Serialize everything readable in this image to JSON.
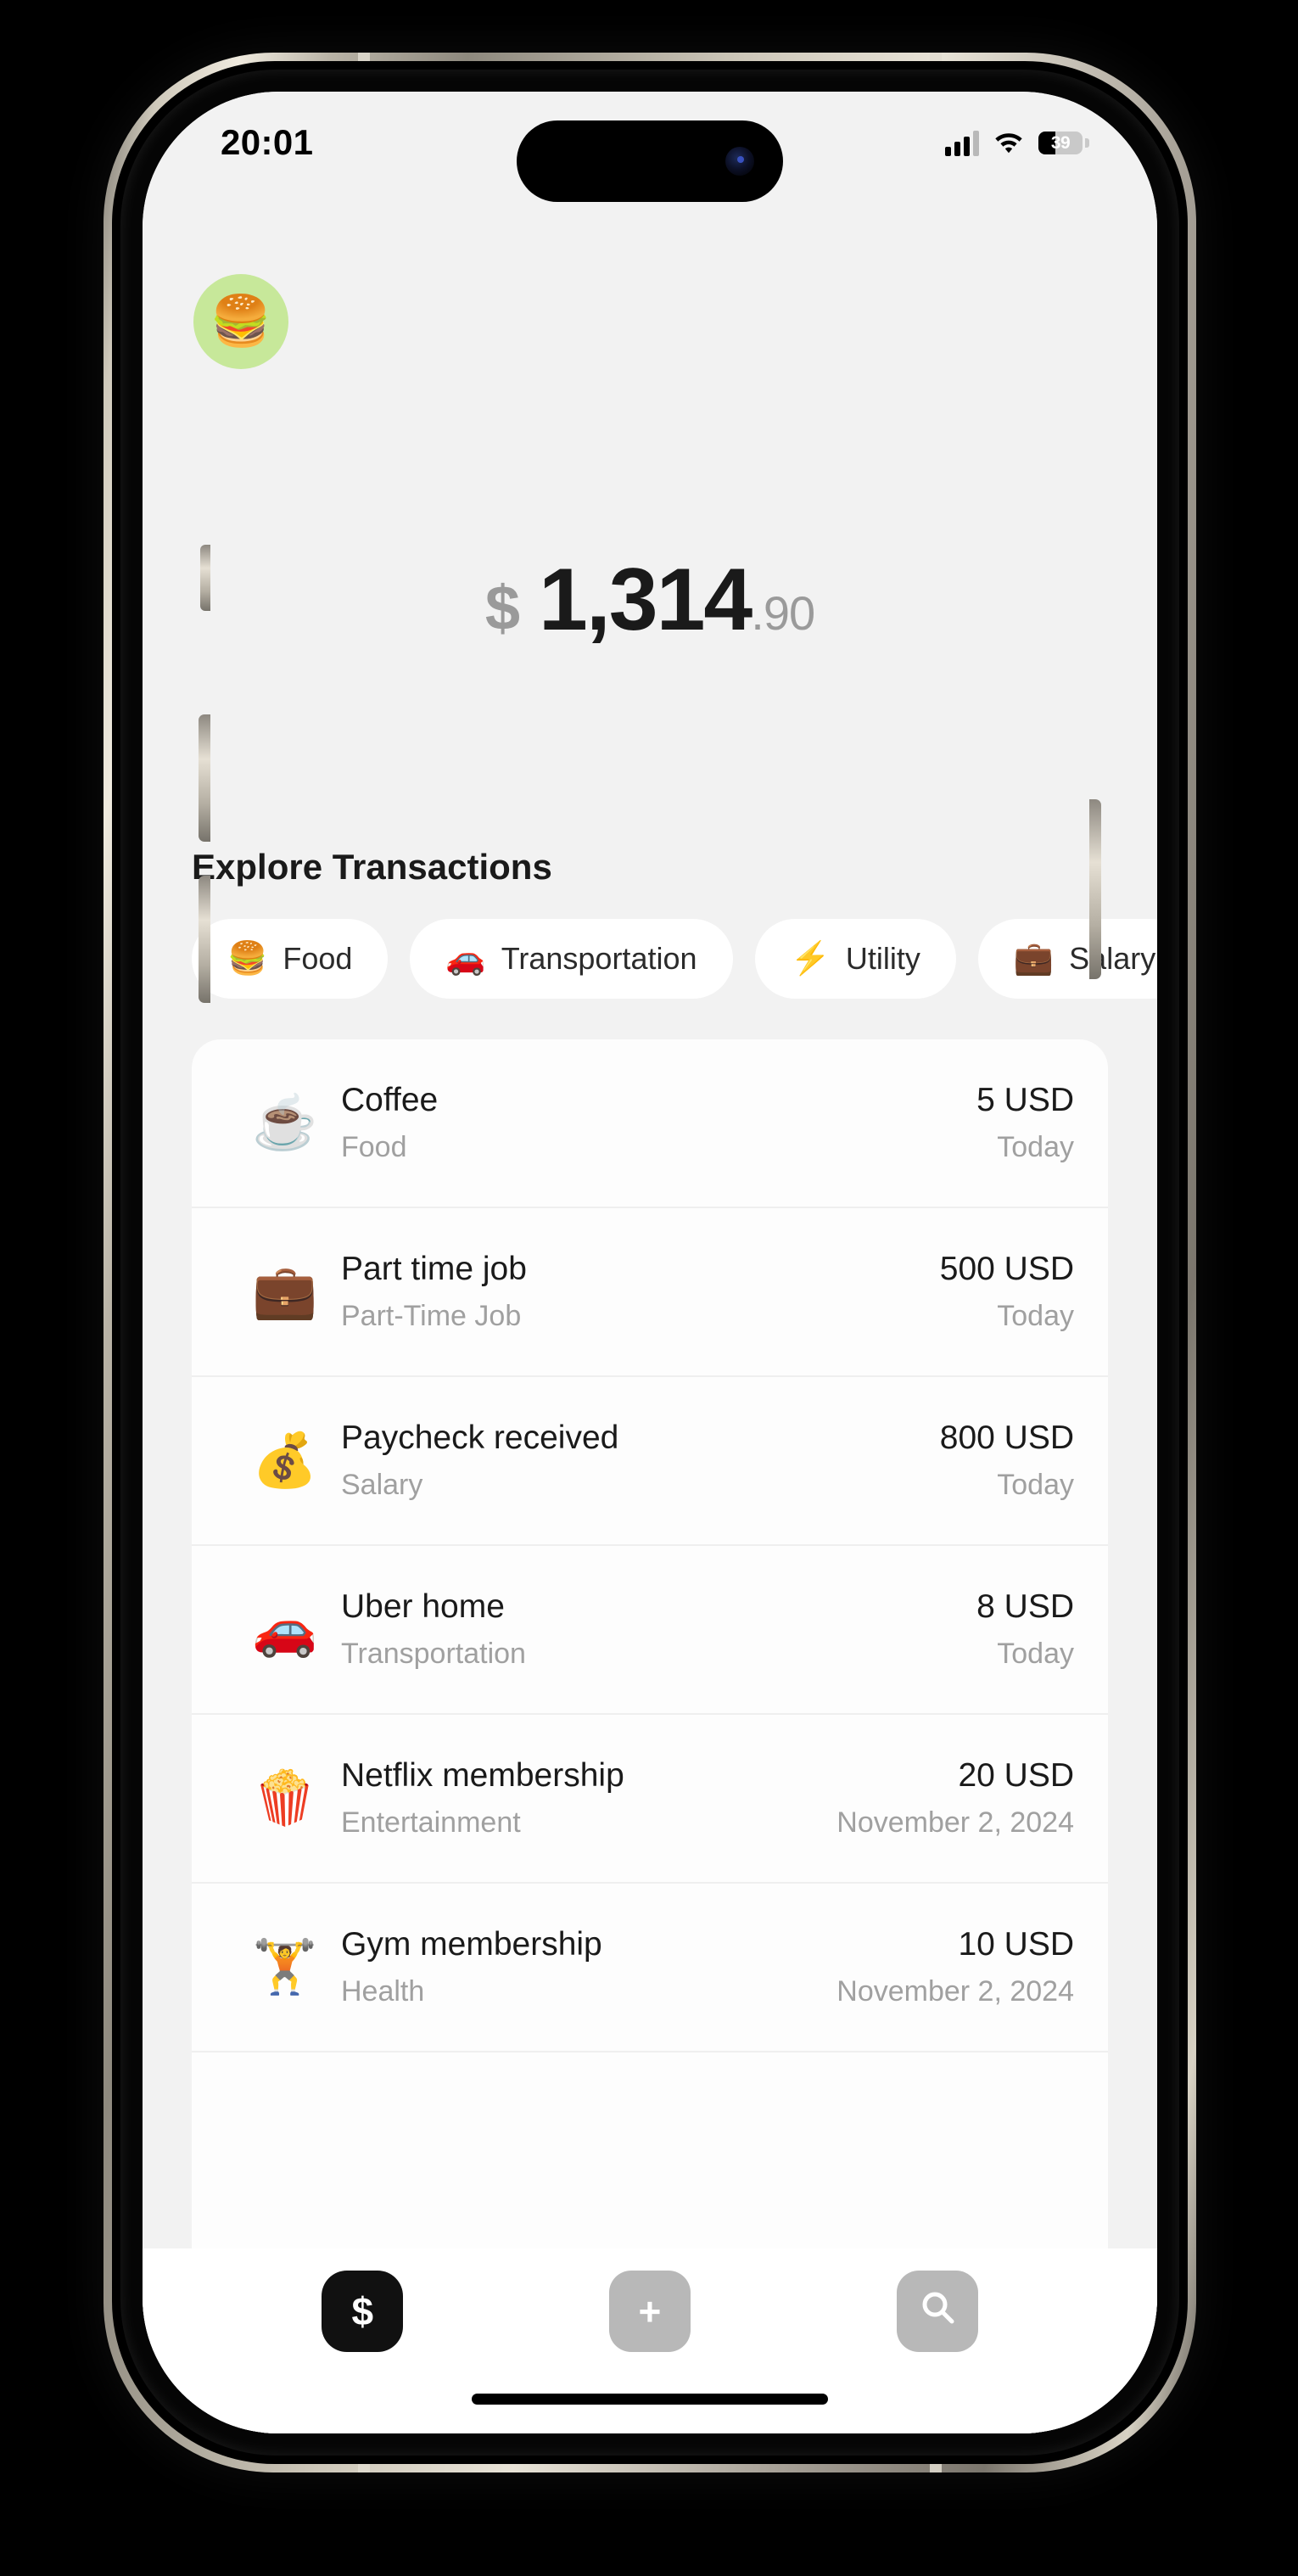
{
  "status_bar": {
    "time": "20:01",
    "battery_level": "39",
    "cellular_icon": "cellular-bars-icon",
    "wifi_icon": "wifi-icon",
    "battery_icon": "battery-icon"
  },
  "header": {
    "avatar_emoji": "🍔",
    "avatar_bg": "#c7e89a"
  },
  "balance": {
    "currency_symbol": "$",
    "integer_part": "1,314",
    "decimal_part": ".90"
  },
  "section": {
    "title": "Explore Transactions"
  },
  "chips": [
    {
      "emoji": "🍔",
      "label": "Food"
    },
    {
      "emoji": "🚗",
      "label": "Transportation"
    },
    {
      "emoji": "⚡",
      "label": "Utility"
    },
    {
      "emoji": "💼",
      "label": "Salary"
    }
  ],
  "transactions": [
    {
      "emoji": "☕",
      "title": "Coffee",
      "category": "Food",
      "amount": "5 USD",
      "date": "Today"
    },
    {
      "emoji": "💼",
      "title": "Part time job",
      "category": "Part-Time Job",
      "amount": "500 USD",
      "date": "Today"
    },
    {
      "emoji": "💰",
      "title": "Paycheck received",
      "category": "Salary",
      "amount": "800 USD",
      "date": "Today"
    },
    {
      "emoji": "🚗",
      "title": "Uber home",
      "category": "Transportation",
      "amount": "8 USD",
      "date": "Today"
    },
    {
      "emoji": "🍿",
      "title": "Netflix membership",
      "category": "Entertainment",
      "amount": "20 USD",
      "date": "November 2, 2024"
    },
    {
      "emoji": "🏋️",
      "title": "Gym membership",
      "category": "Health",
      "amount": "10 USD",
      "date": "November 2, 2024"
    }
  ],
  "tabbar": {
    "money_label": "$",
    "add_label": "+",
    "search_icon": "search-icon"
  },
  "colors": {
    "screen_bg": "#f2f2f2",
    "card_bg": "#fdfdfd",
    "accent_dark": "#111111",
    "muted": "#a0a0a0",
    "inactive_tab": "#b8b8b8"
  }
}
